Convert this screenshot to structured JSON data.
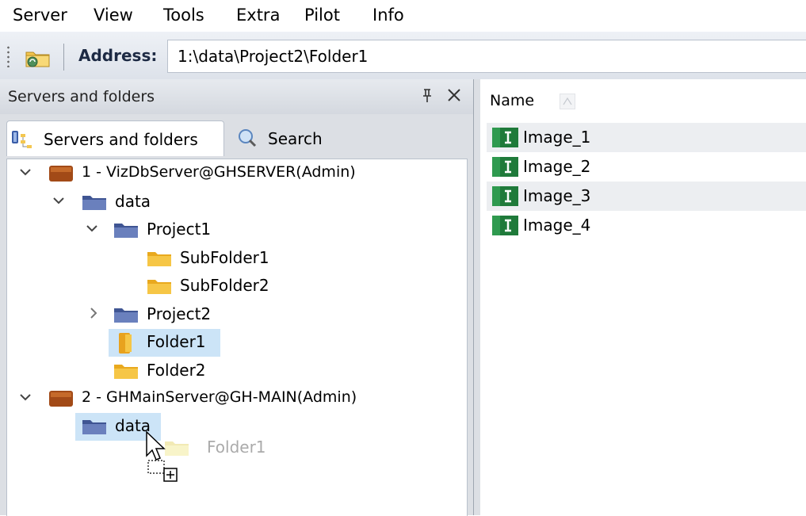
{
  "menu": [
    "Server",
    "View",
    "Tools",
    "Extra",
    "Pilot",
    "Info"
  ],
  "toolbar": {
    "address_label": "Address:",
    "address_value": "1:\\data\\Project2\\Folder1"
  },
  "left_pane": {
    "title": "Servers and folders",
    "tabs": [
      {
        "label": "Servers and folders",
        "active": true
      },
      {
        "label": "Search",
        "active": false
      }
    ],
    "tree": [
      {
        "label": "1 - VizDbServer@GHSERVER(Admin)",
        "type": "server",
        "expanded": true
      },
      {
        "label": "data",
        "type": "db-folder",
        "expanded": true
      },
      {
        "label": "Project1",
        "type": "db-folder",
        "expanded": true
      },
      {
        "label": "SubFolder1",
        "type": "folder"
      },
      {
        "label": "SubFolder2",
        "type": "folder"
      },
      {
        "label": "Project2",
        "type": "db-folder",
        "expanded": false
      },
      {
        "label": "Folder1",
        "type": "open-folder",
        "selected": true
      },
      {
        "label": "Folder2",
        "type": "folder"
      },
      {
        "label": "2 - GHMainServer@GH-MAIN(Admin)",
        "type": "server",
        "expanded": true
      },
      {
        "label": "data",
        "type": "db-folder",
        "highlighted": true
      }
    ],
    "drag_ghost_label": "Folder1"
  },
  "right_pane": {
    "column": "Name",
    "items": [
      "Image_1",
      "Image_2",
      "Image_3",
      "Image_4"
    ]
  },
  "colors": {
    "selection": "#cce4f7",
    "folder_yellow": "#f6c646",
    "db_folder_blue": "#5a6fa8",
    "server_brown": "#a24a17",
    "image_green": "#1f7a3a"
  }
}
